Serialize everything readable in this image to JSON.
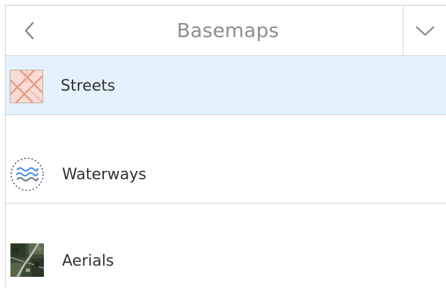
{
  "header": {
    "title": "Basemaps",
    "back_icon": "chevron-left-icon",
    "collapse_icon": "chevron-down-icon"
  },
  "basemaps": [
    {
      "label": "Streets",
      "icon": "streets-map-thumbnail",
      "selected": true
    },
    {
      "label": "Waterways",
      "icon": "waterways-map-thumbnail",
      "selected": false
    },
    {
      "label": "Aerials",
      "icon": "aerials-map-thumbnail",
      "selected": false
    }
  ],
  "colors": {
    "selected_background": "#e3f2fc",
    "title_text": "#8e8e8e",
    "item_text": "#323232"
  }
}
